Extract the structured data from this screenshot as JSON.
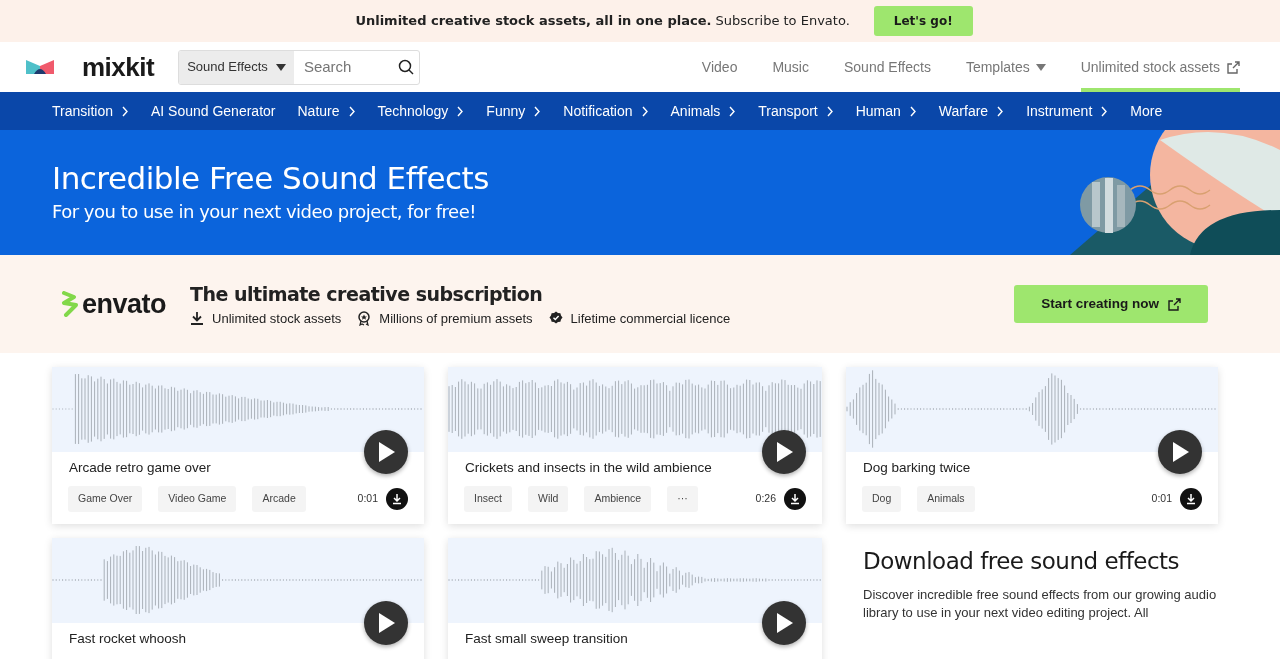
{
  "promo_bar": {
    "text": "**Unlimited creative stock assets, all in one place.** Subscribe to Envato.",
    "button": "Let's go!"
  },
  "header": {
    "logo": "mixkit",
    "search": {
      "category": "Sound Effects",
      "placeholder": "Search"
    },
    "nav": [
      {
        "label": "Video",
        "kind": "link",
        "selected": false
      },
      {
        "label": "Music",
        "kind": "link",
        "selected": false
      },
      {
        "label": "Sound Effects",
        "kind": "link",
        "selected": false
      },
      {
        "label": "Templates",
        "kind": "dropdown",
        "selected": false
      },
      {
        "label": "Unlimited stock assets",
        "kind": "external",
        "selected": true
      }
    ]
  },
  "category_nav": [
    {
      "label": "Transition",
      "has_submenu": true
    },
    {
      "label": "AI Sound Generator",
      "has_submenu": false
    },
    {
      "label": "Nature",
      "has_submenu": true
    },
    {
      "label": "Technology",
      "has_submenu": true
    },
    {
      "label": "Funny",
      "has_submenu": true
    },
    {
      "label": "Notification",
      "has_submenu": true
    },
    {
      "label": "Animals",
      "has_submenu": true
    },
    {
      "label": "Transport",
      "has_submenu": true
    },
    {
      "label": "Human",
      "has_submenu": true
    },
    {
      "label": "Warfare",
      "has_submenu": true
    },
    {
      "label": "Instrument",
      "has_submenu": true
    },
    {
      "label": "More",
      "has_submenu": false
    }
  ],
  "hero": {
    "title": "Incredible Free Sound Effects",
    "subtitle": "For you to use in your next video project, for free!"
  },
  "envato_banner": {
    "logo": "envato",
    "title": "The ultimate creative subscription",
    "features": [
      {
        "text": "Unlimited stock assets",
        "kind": "download"
      },
      {
        "text": "Millions of premium assets",
        "kind": "award"
      },
      {
        "text": "Lifetime commercial licence",
        "kind": "verified"
      }
    ],
    "button": "Start creating now"
  },
  "sound_cards": [
    {
      "title": "Arcade retro game over",
      "tags": [
        "Game Over",
        "Video Game",
        "Arcade"
      ],
      "duration": "0:01"
    },
    {
      "title": "Crickets and insects in the wild ambience",
      "tags": [
        "Insect",
        "Wild",
        "Ambience",
        "···"
      ],
      "duration": "0:26"
    },
    {
      "title": "Dog barking twice",
      "tags": [
        "Dog",
        "Animals"
      ],
      "duration": "0:01"
    },
    {
      "title": "Fast rocket whoosh"
    },
    {
      "title": "Fast small sweep transition"
    }
  ],
  "info": {
    "title": "Download free sound effects",
    "text": "Discover incredible free sound effects from our growing audio library to use in your next video editing project. All"
  }
}
